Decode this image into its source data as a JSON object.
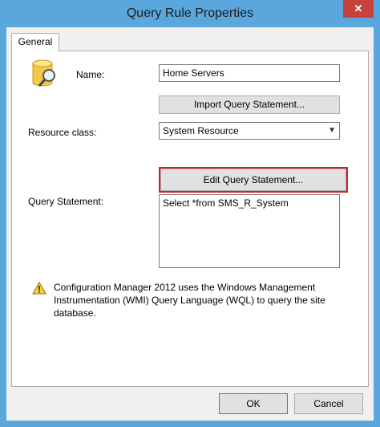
{
  "window": {
    "title": "Query Rule Properties",
    "close_glyph": "✕"
  },
  "tabs": [
    {
      "label": "General"
    }
  ],
  "form": {
    "name_label": "Name:",
    "name_value": "Home Servers",
    "import_button": "Import Query Statement...",
    "resource_class_label": "Resource class:",
    "resource_class_value": "System Resource",
    "edit_button": "Edit Query Statement...",
    "query_statement_label": "Query Statement:",
    "query_statement_value": "Select *from SMS_R_System"
  },
  "note": "Configuration Manager 2012 uses the Windows Management Instrumentation (WMI) Query Language (WQL) to query the site database.",
  "footer": {
    "ok": "OK",
    "cancel": "Cancel"
  },
  "colors": {
    "titlebar": "#5aa7de",
    "close": "#c7423c",
    "highlight": "#d2232a"
  },
  "icons": {
    "rule": "database-query-icon",
    "warning": "warning-icon"
  }
}
